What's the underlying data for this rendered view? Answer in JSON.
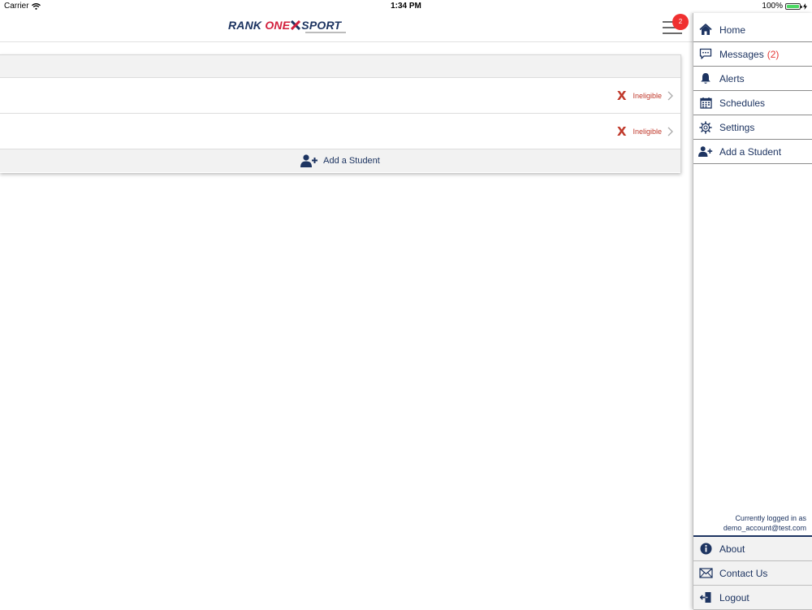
{
  "status_bar": {
    "carrier": "Carrier",
    "time": "1:34 PM",
    "battery": "100%"
  },
  "header": {
    "logo": {
      "word1": "RANK",
      "word2": "ONE",
      "word3": "SPORT"
    },
    "notification_count": "2"
  },
  "students": [
    {
      "status_icon": "X",
      "status": "Ineligible"
    },
    {
      "status_icon": "X",
      "status": "Ineligible"
    }
  ],
  "add_student_label": "Add a Student",
  "side_menu": {
    "items": [
      {
        "label": "Home",
        "icon": "home-icon"
      },
      {
        "label": "Messages",
        "count": "(2)",
        "icon": "chat-bubble-icon"
      },
      {
        "label": "Alerts",
        "icon": "bell-icon"
      },
      {
        "label": "Schedules",
        "icon": "calendar-icon"
      },
      {
        "label": "Settings",
        "icon": "gear-icon"
      },
      {
        "label": "Add a Student",
        "icon": "add-user-icon"
      }
    ],
    "login_text": "Currently logged in as",
    "login_email": "demo_account@test.com",
    "bottom_items": [
      {
        "label": "About",
        "icon": "info-icon"
      },
      {
        "label": "Contact Us",
        "icon": "envelope-icon"
      },
      {
        "label": "Logout",
        "icon": "logout-icon"
      }
    ]
  },
  "colors": {
    "navy": "#1d3461",
    "red": "#d21f3c",
    "ineligible": "#c0392b",
    "badge": "#f03030"
  }
}
